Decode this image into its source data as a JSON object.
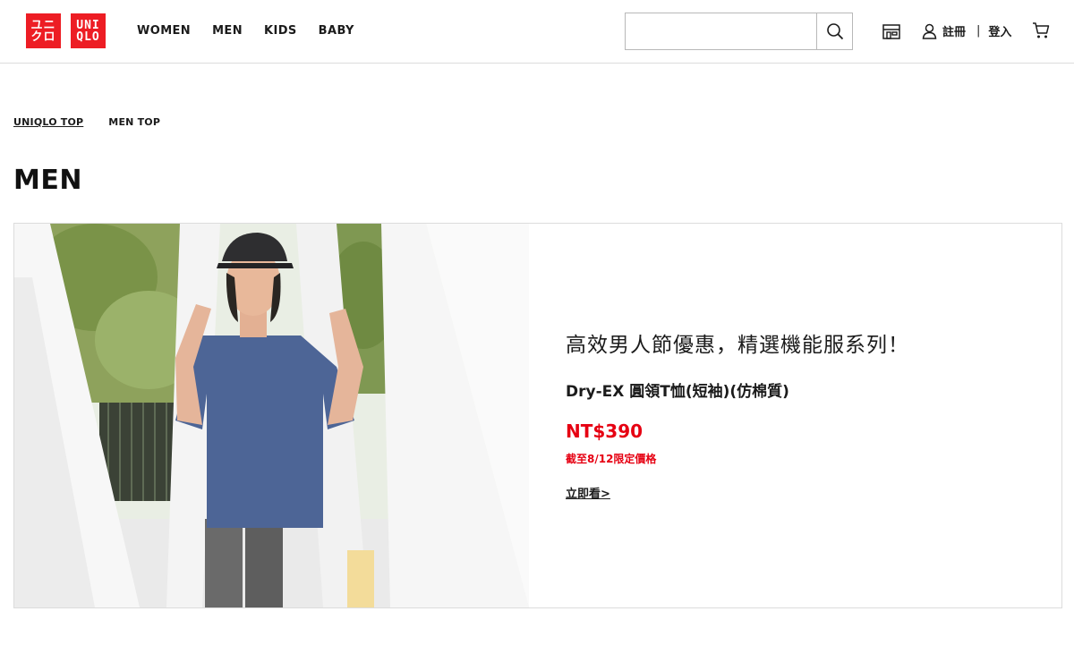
{
  "header": {
    "logo": {
      "top_text": "ユニクロ",
      "bottom_text": "UNIQLO"
    },
    "nav": [
      {
        "label": "WOMEN"
      },
      {
        "label": "MEN"
      },
      {
        "label": "KIDS"
      },
      {
        "label": "BABY"
      }
    ],
    "search": {
      "placeholder": "",
      "value": ""
    },
    "account": {
      "register": "註冊",
      "separator": "|",
      "login": "登入"
    }
  },
  "breadcrumb": {
    "home": "UNIQLO TOP",
    "current": "MEN TOP"
  },
  "page_title": "MEN",
  "banner": {
    "headline": "高效男人節優惠，精選機能服系列！",
    "product_name": "Dry-EX 圓領T恤(短袖)(仿棉質)",
    "price": "NT$390",
    "price_note": "截至8/12限定價格",
    "cta": "立即看>"
  },
  "colors": {
    "brand_red": "#ed1d24",
    "price_red": "#e60012",
    "text": "#1b1b1b"
  }
}
